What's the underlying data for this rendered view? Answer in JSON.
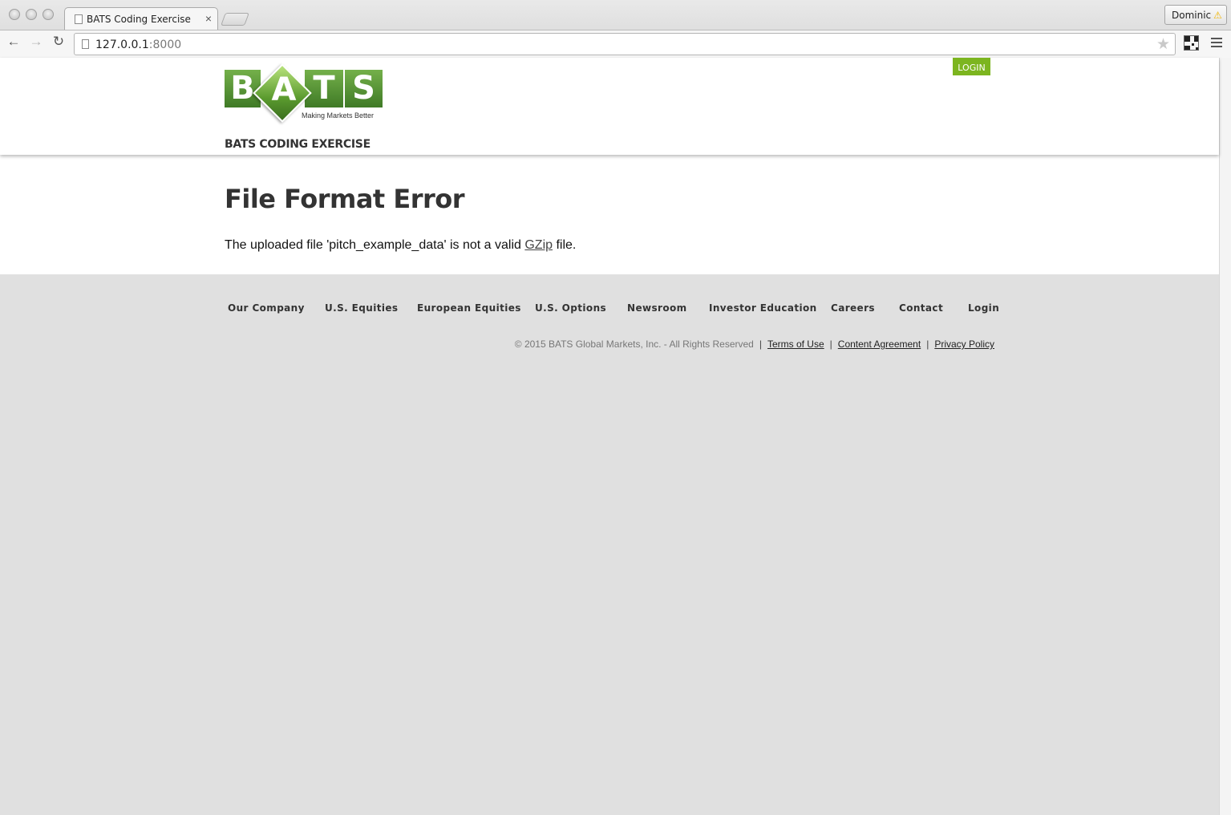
{
  "browser": {
    "tab_title": "BATS Coding Exercise",
    "tab_close": "×",
    "profile_name": "Dominic",
    "profile_warning": "⚠",
    "url_host": "127.0.0.1",
    "url_port": ":8000",
    "back": "←",
    "forward": "→",
    "reload": "↻",
    "star": "★"
  },
  "header": {
    "logo_letters": [
      "B",
      "A",
      "T",
      "S"
    ],
    "logo_tagline": "Making Markets Better",
    "login_label": "LOGIN",
    "site_title": "BATS CODING EXERCISE"
  },
  "content": {
    "title": "File Format Error",
    "message_before": "The uploaded file 'pitch_example_data' is not a valid ",
    "message_link": "GZip",
    "message_after": " file."
  },
  "footer": {
    "nav": [
      "Our Company",
      "U.S. Equities",
      "European Equities",
      "U.S. Options",
      "Newsroom",
      "Investor Education",
      "Careers",
      "Contact",
      "Login"
    ],
    "copyright": "© 2015 BATS Global Markets, Inc. - All Rights Reserved",
    "links": [
      "Terms of Use",
      "Content Agreement",
      "Privacy Policy"
    ],
    "separator": "|"
  },
  "colors": {
    "accent_green": "#7cb51f",
    "page_background": "#e0e0e0"
  }
}
